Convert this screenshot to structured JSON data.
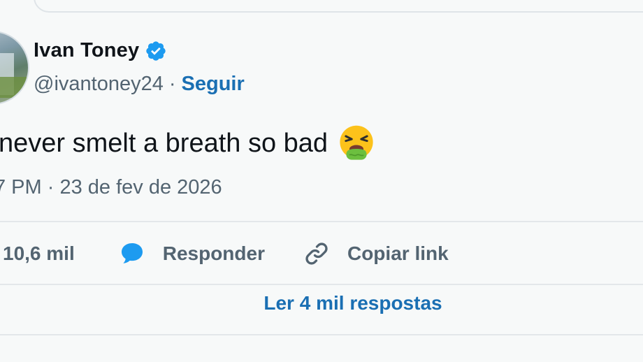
{
  "tweet": {
    "author": {
      "display_name": "Ivan Toney",
      "handle": "@ivantoney24",
      "verified": true,
      "avatar_icon": "profile-photo"
    },
    "separator": "·",
    "follow_label": "Seguir",
    "text": "never smelt a breath so bad",
    "emoji": "face-vomiting-emoji",
    "timestamp": "7 PM · 23 de fev de 2026"
  },
  "actions": {
    "likes_count": "10,6 mil",
    "reply_label": "Responder",
    "reply_icon": "speech-bubble-icon",
    "copy_label": "Copiar link",
    "copy_icon": "link-icon"
  },
  "footer": {
    "read_replies_label": "Ler 4 mil respostas"
  },
  "colors": {
    "background": "#f7f9f9",
    "text_primary": "#0f1419",
    "text_secondary": "#536471",
    "link": "#1a6fb3",
    "verified_badge": "#1d9bf0",
    "reply_icon": "#1d9bf0",
    "divider": "#e3e7ea"
  }
}
